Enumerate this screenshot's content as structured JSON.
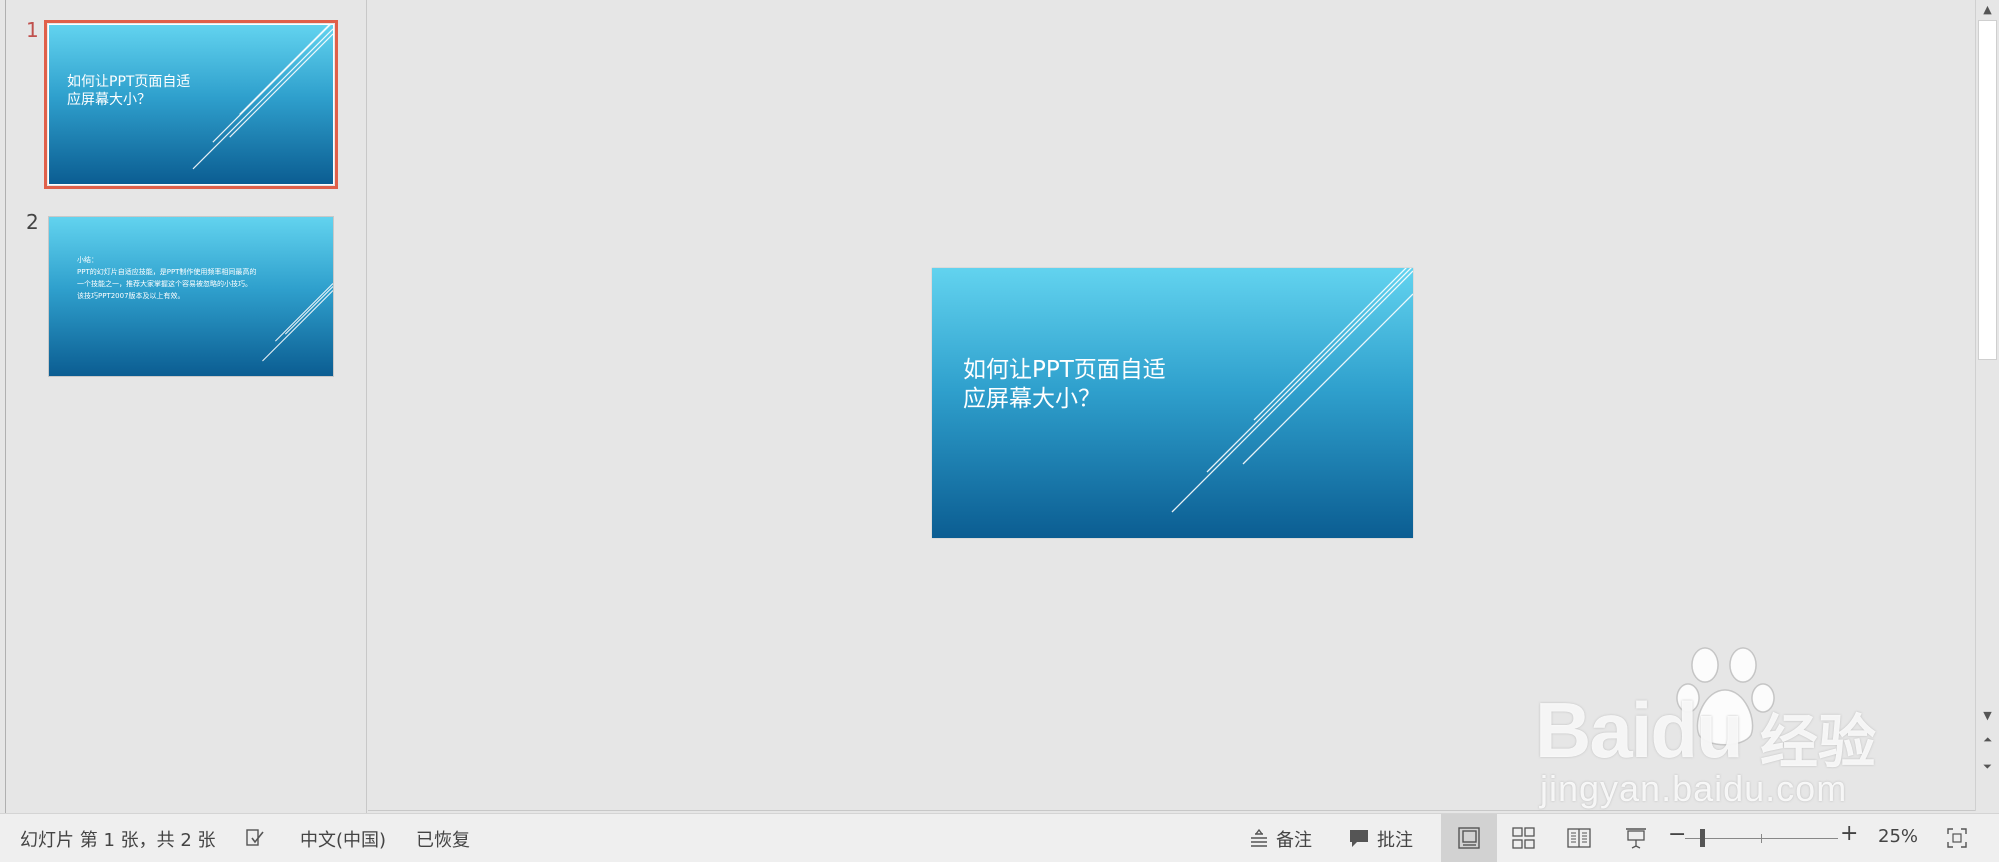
{
  "thumbnails": [
    {
      "number": "1",
      "title": "如何让PPT页面自适\n应屏幕大小？"
    },
    {
      "number": "2",
      "body": "小结：\nPPT的幻灯片自适应技能，是PPT制作使用频率相同最高的\n一个技能之一，推荐大家掌握这个容易被忽略的小技巧。\n该技巧PPT2007版本及以上有效。"
    }
  ],
  "main_slide": {
    "title": "如何让PPT页面自适\n应屏幕大小？"
  },
  "statusbar": {
    "slide_info": "幻灯片 第 1 张，共 2 张",
    "language": "中文(中国)",
    "recovery": "已恢复",
    "notes_label": "备注",
    "comments_label": "批注",
    "zoom_level": "25%"
  },
  "watermark": {
    "brand": "Baidu",
    "product": "经验",
    "url": "jingyan.baidu.com"
  },
  "colors": {
    "accent": "#e0604a",
    "slide_top": "#62d3ef",
    "slide_bottom": "#0b5d92"
  },
  "icons": [
    "spellcheck-icon",
    "notes-icon",
    "comment-icon",
    "normal-view-icon",
    "slide-sorter-icon",
    "reading-view-icon",
    "slideshow-icon",
    "fit-to-window-icon"
  ]
}
